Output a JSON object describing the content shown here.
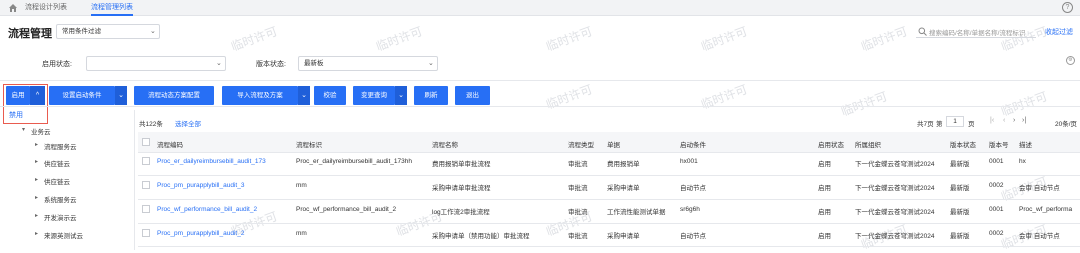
{
  "tabs": [
    {
      "label": "流程设计列表"
    },
    {
      "label": "流程管理列表"
    }
  ],
  "header": {
    "title": "流程管理",
    "filter_select": "常用条件过滤",
    "search_placeholder": "搜索编码/名称/单据名称/流程标识",
    "collapse_label": "收起过滤"
  },
  "watermark": "临时许可",
  "filters": {
    "enable_status_label": "启用状态:",
    "enable_status_value": "",
    "version_status_label": "版本状态:",
    "version_status_value": "最新板"
  },
  "toolbar": {
    "enable": "启用",
    "set_start_condition": "设置启动条件",
    "dynamic_config": "流程动态方案配置",
    "import": "导入流程及方案",
    "verify": "校验",
    "change_query": "变更查询",
    "refresh": "刷新",
    "exit": "退出"
  },
  "dropdown": {
    "disable": "禁用"
  },
  "tree": {
    "root": "业务云",
    "items": [
      "流程服务云",
      "供应链云",
      "供应链云",
      "系统服务云",
      "开发演示云",
      "来源英测试云"
    ]
  },
  "summary": {
    "total": "共122条",
    "select_all": "选择全部"
  },
  "pager": {
    "total_pages": "共7页",
    "page_prefix": "第",
    "current_page": "1",
    "page_suffix": "页",
    "page_size": "20条/页"
  },
  "table": {
    "headers": [
      "流程编码",
      "流程标识",
      "流程名称",
      "流程类型",
      "单据",
      "启动条件",
      "启用状态",
      "所属组织",
      "版本状态",
      "版本号",
      "描述"
    ],
    "rows": [
      [
        "Proc_er_dailyreimbursebill_audit_173",
        "Proc_er_dailyreimbursebill_audit_173hh",
        "费用报销单审批流程",
        "审批流",
        "费用报销单",
        "hx001",
        "启用",
        "下一代金蝶云苍穹测试2024",
        "最新版",
        "0001",
        "hx"
      ],
      [
        "Proc_pm_purapplybill_audit_3",
        "mm",
        "采购申请单审批流程",
        "审批流",
        "采购申请单",
        "自动节点",
        "启用",
        "下一代金蝶云苍穹测试2024",
        "最新版",
        "0002",
        "会审 自动节点"
      ],
      [
        "Proc_wf_performance_bill_audit_2",
        "Proc_wf_performance_bill_audit_2",
        "log工作流2审批流程",
        "审批流",
        "工作流性能测试单据",
        "sr6g6h",
        "启用",
        "下一代金蝶云苍穹测试2024",
        "最新版",
        "0001",
        "Proc_wf_performa"
      ],
      [
        "Proc_pm_purapplybill_audit_2",
        "mm",
        "采购申请单（禁用功能）审批流程",
        "审批流",
        "采购申请单",
        "自动节点",
        "启用",
        "下一代金蝶云苍穹测试2024",
        "最新版",
        "0002",
        "会审 自动节点"
      ]
    ]
  }
}
